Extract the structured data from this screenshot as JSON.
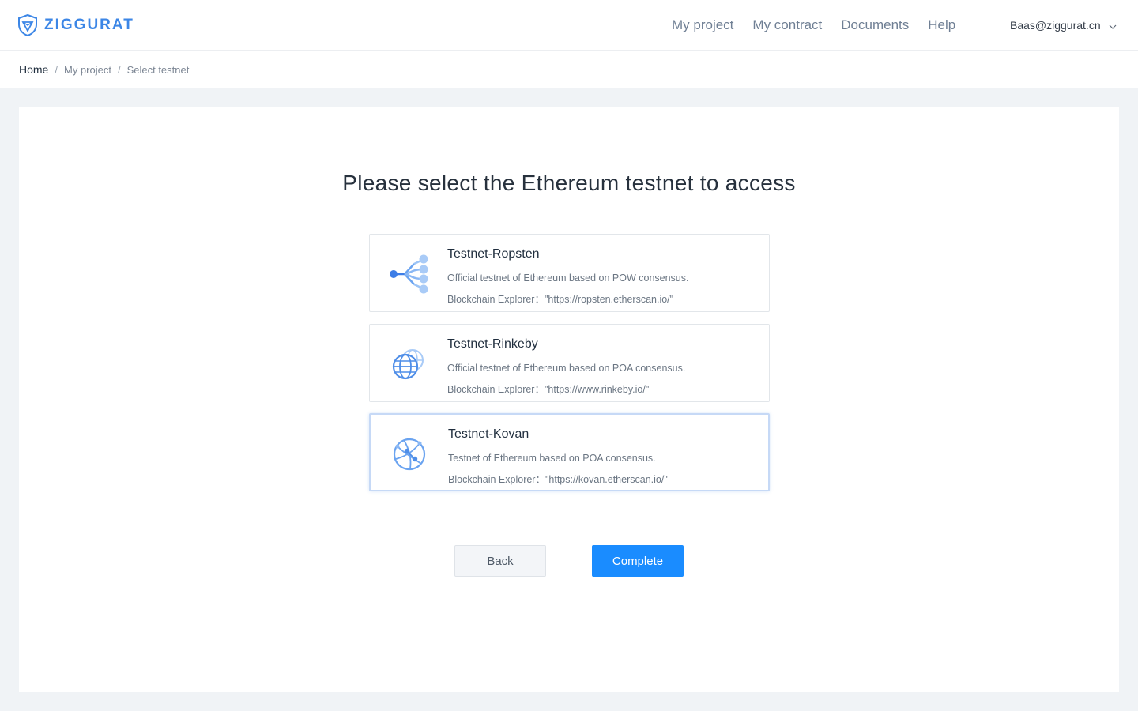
{
  "header": {
    "logo_text": "ZIGGURAT",
    "nav": [
      "My project",
      "My contract",
      "Documents",
      "Help"
    ],
    "user_email": "Baas@ziggurat.cn"
  },
  "breadcrumb": {
    "home": "Home",
    "items": [
      "My project",
      "Select testnet"
    ],
    "separator": "/"
  },
  "main": {
    "title": "Please select the Ethereum testnet to access",
    "options": [
      {
        "name": "Testnet-Ropsten",
        "description": "Official testnet of Ethereum based on POW consensus.",
        "explorer": "Blockchain Explorer：\"https://ropsten.etherscan.io/\"",
        "icon": "network-branch-icon",
        "selected": false
      },
      {
        "name": "Testnet-Rinkeby",
        "description": "Official testnet of Ethereum based on POA consensus.",
        "explorer": "Blockchain Explorer：\"https://www.rinkeby.io/\"",
        "icon": "globe-icon",
        "selected": false
      },
      {
        "name": "Testnet-Kovan",
        "description": "Testnet of Ethereum based on POA consensus.",
        "explorer": "Blockchain Explorer：\"https://kovan.etherscan.io/\"",
        "icon": "globe-network-icon",
        "selected": true
      }
    ],
    "back_label": "Back",
    "complete_label": "Complete"
  },
  "colors": {
    "accent": "#1a8cff",
    "brand": "#3c86e6",
    "background": "#f0f3f6"
  }
}
